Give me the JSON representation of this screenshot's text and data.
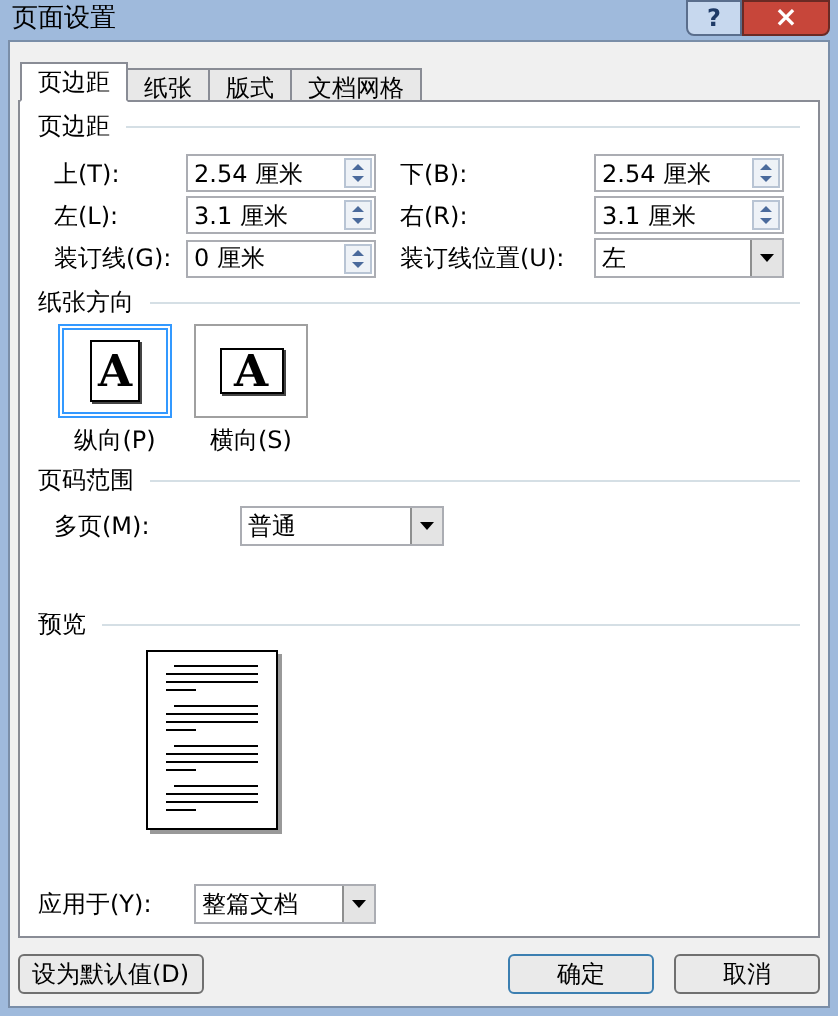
{
  "window": {
    "title": "页面设置",
    "help_glyph": "?",
    "close_glyph": "×"
  },
  "tabs": [
    {
      "label": "页边距",
      "selected": true
    },
    {
      "label": "纸张",
      "selected": false
    },
    {
      "label": "版式",
      "selected": false
    },
    {
      "label": "文档网格",
      "selected": false
    }
  ],
  "margins": {
    "title": "页边距",
    "fields": [
      {
        "label": "上(T):",
        "value": "2.54 厘米",
        "kind": "spin"
      },
      {
        "label": "下(B):",
        "value": "2.54 厘米",
        "kind": "spin"
      },
      {
        "label": "左(L):",
        "value": "3.1 厘米",
        "kind": "spin"
      },
      {
        "label": "右(R):",
        "value": "3.1 厘米",
        "kind": "spin"
      },
      {
        "label": "装订线(G):",
        "value": "0 厘米",
        "kind": "spin"
      },
      {
        "label": "装订线位置(U):",
        "value": "左",
        "kind": "select"
      }
    ]
  },
  "orientation": {
    "title": "纸张方向",
    "options": [
      {
        "label": "纵向(P)",
        "glyph": "A",
        "kind": "portrait",
        "selected": true
      },
      {
        "label": "横向(S)",
        "glyph": "A",
        "kind": "landscape",
        "selected": false
      }
    ]
  },
  "page_range": {
    "title": "页码范围",
    "label": "多页(M):",
    "value": "普通"
  },
  "preview": {
    "title": "预览",
    "apply_label": "应用于(Y):",
    "apply_value": "整篇文档"
  },
  "buttons": [
    {
      "label": "设为默认值(D)",
      "kind": "default"
    },
    {
      "label": "确定",
      "kind": "ok"
    },
    {
      "label": "取消",
      "kind": "cancel"
    }
  ]
}
